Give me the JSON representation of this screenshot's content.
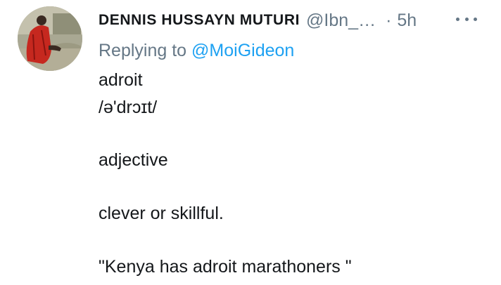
{
  "tweet": {
    "display_name": "DENNIS HUSSAYN MUTURI",
    "handle": "@Ibn_…",
    "separator": "·",
    "time": "5h",
    "replying_prefix": "Replying to",
    "replying_to": "@MoiGideon",
    "body": {
      "word": "adroit",
      "pronunciation": "/ə'drɔɪt/",
      "part_of_speech": "adjective",
      "definition": "clever or skillful.",
      "example": "\"Kenya has adroit marathoners \""
    }
  },
  "icons": {
    "more": "more-horizontal-icon",
    "avatar": "profile-photo"
  },
  "colors": {
    "text": "#14171a",
    "muted": "#657786",
    "link": "#1da1f2",
    "background": "#ffffff"
  }
}
